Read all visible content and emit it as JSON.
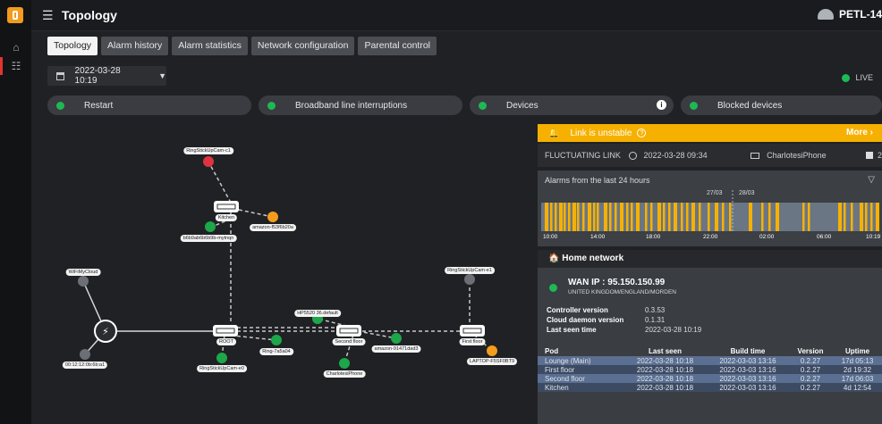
{
  "header": {
    "title": "Topology",
    "user": "PETL-14"
  },
  "tabs": [
    {
      "label": "Topology"
    },
    {
      "label": "Alarm history"
    },
    {
      "label": "Alarm statistics"
    },
    {
      "label": "Network configuration"
    },
    {
      "label": "Parental control"
    }
  ],
  "date": {
    "value": "2022-03-28 10:19"
  },
  "live_label": "LIVE",
  "pills": [
    {
      "label": "Restart"
    },
    {
      "label": "Broadband line interruptions"
    },
    {
      "label": "Devices"
    },
    {
      "label": "Blocked devices"
    }
  ],
  "topology": {
    "nodes": [
      {
        "label": "RingStickUpCam-c1",
        "status": "alert"
      },
      {
        "label": "Kitchen"
      },
      {
        "label": "b6b9ab6b6b9b-mytnqn"
      },
      {
        "label": "amazon-f53f6b20a"
      },
      {
        "label": "WiFiMyCloud"
      },
      {
        "label": "00:12:12:0b:6b:a1"
      },
      {
        "label": "ROOT"
      },
      {
        "label": "RingStickUpCam-e0"
      },
      {
        "label": "HP5520 36.default"
      },
      {
        "label": "Ring-7a5a04"
      },
      {
        "label": "Second floor"
      },
      {
        "label": "amazon-91471dad3"
      },
      {
        "label": "CharlotesiPhone"
      },
      {
        "label": "RingStickUpCam-e1"
      },
      {
        "label": "First floor"
      },
      {
        "label": "LAPTOP-F5SF0BT9"
      }
    ]
  },
  "alert": {
    "message": "Link is unstable",
    "more": "More"
  },
  "link": {
    "type": "FLUCTUATING LINK",
    "time": "2022-03-28 09:34",
    "device": "CharlotesiPhone",
    "count": "2"
  },
  "alarms": {
    "title": "Alarms from the last 24 hours",
    "date_labels": [
      "27/03",
      "28/03"
    ],
    "time_labels": [
      "10:00",
      "14:00",
      "18:00",
      "22:00",
      "02:00",
      "06:00",
      "10:19"
    ]
  },
  "home": {
    "title": "Home network",
    "wan_ip": "WAN IP : 95.150.150.99",
    "location": "UNITED KINGDOM/ENGLAND/MORDEN",
    "controller_label": "Controller version",
    "controller_value": "0.3.53",
    "cloud_label": "Cloud daemon version",
    "cloud_value": "0.1.31",
    "seen_label": "Last seen time",
    "seen_value": "2022-03-28 10:19",
    "columns": [
      "Pod",
      "Last seen",
      "Build time",
      "Version",
      "Uptime"
    ],
    "pods": [
      [
        "Lounge (Main)",
        "2022-03-28 10:18",
        "2022-03-03 13:16",
        "0.2.27",
        "17d 05:13"
      ],
      [
        "First floor",
        "2022-03-28 10:18",
        "2022-03-03 13:16",
        "0.2.27",
        "2d 19:32"
      ],
      [
        "Second floor",
        "2022-03-28 10:18",
        "2022-03-03 13:16",
        "0.2.27",
        "17d 06:03"
      ],
      [
        "Kitchen",
        "2022-03-28 10:18",
        "2022-03-03 13:16",
        "0.2.27",
        "4d 12:54"
      ]
    ]
  },
  "colors": {
    "accent": "#f6b100",
    "ok": "#1db954",
    "error": "#e03340",
    "orange": "#f39c1e"
  }
}
